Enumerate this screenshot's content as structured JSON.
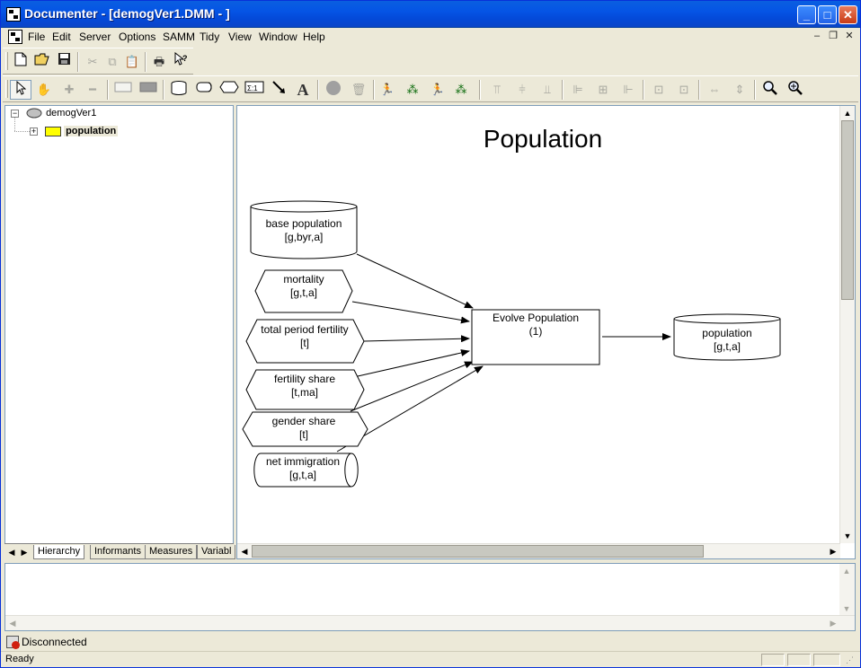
{
  "window": {
    "title": "Documenter - [demogVer1.DMM - ]"
  },
  "menubar": {
    "items": [
      "File",
      "Edit",
      "Server",
      "Options",
      "SAMM",
      "Tidy",
      "View",
      "Window",
      "Help"
    ],
    "mdi_minimize": "–",
    "mdi_restore": "❐",
    "mdi_close": "✕"
  },
  "toolbar": {
    "file_icons": [
      "new-file-icon",
      "open-folder-icon",
      "save-disk-icon",
      "cut-icon",
      "copy-icon",
      "paste-icon",
      "print-icon",
      "help-pointer-icon"
    ],
    "drawing_text_glyph": "A",
    "sigma_glyph": "Σ:1"
  },
  "tree": {
    "root": "demogVer1",
    "child": "population"
  },
  "tabs": [
    "Hierarchy",
    "Informants",
    "Measures",
    "Variabl"
  ],
  "diagram": {
    "title": "Population",
    "nodes": {
      "base_population": {
        "label": "base population",
        "index": "[g,byr,a]"
      },
      "mortality": {
        "label": "mortality",
        "index": "[g,t,a]"
      },
      "total_period_fertility": {
        "label": "total period fertility",
        "index": "[t]"
      },
      "fertility_share": {
        "label": "fertility share",
        "index": "[t,ma]"
      },
      "gender_share": {
        "label": "gender share",
        "index": "[t]"
      },
      "net_immigration": {
        "label": "net immigration",
        "index": "[g,t,a]"
      },
      "evolve_population": {
        "label": "Evolve Population",
        "index": "(1)"
      },
      "population_out": {
        "label": "population",
        "index": "[g,t,a]"
      }
    }
  },
  "status": {
    "connection": "Disconnected",
    "ready": "Ready"
  },
  "colors": {
    "titlebar": "#0554e5",
    "tree_folder": "#ffff00",
    "tree_root_ellipse": "#c0c0c0"
  }
}
